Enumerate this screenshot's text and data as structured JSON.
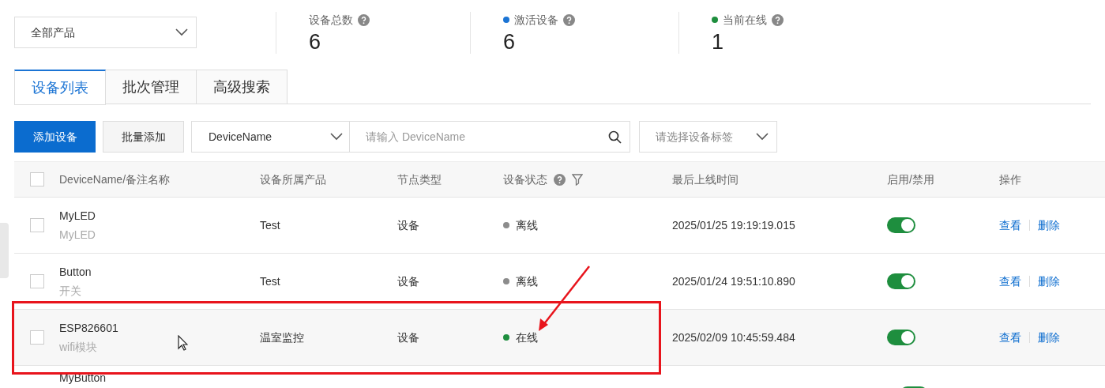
{
  "product_select": {
    "value": "全部产品"
  },
  "stats": [
    {
      "label": "设备总数",
      "value": "6"
    },
    {
      "label": "激活设备",
      "value": "6",
      "color": "#1b74d4"
    },
    {
      "label": "当前在线",
      "value": "1",
      "color": "#1e8e3e"
    }
  ],
  "tabs": [
    {
      "label": "设备列表",
      "selected": true
    },
    {
      "label": "批次管理",
      "selected": false
    },
    {
      "label": "高级搜索",
      "selected": false
    }
  ],
  "toolbar": {
    "add_button": "添加设备",
    "batch_button": "批量添加",
    "field_select": "DeviceName",
    "search": {
      "placeholder": "请输入 DeviceName"
    },
    "tag_select": {
      "placeholder": "请选择设备标签"
    }
  },
  "table": {
    "all_checked": false,
    "columns": [
      "DeviceName/备注名称",
      "设备所属产品",
      "节点类型",
      "设备状态",
      "最后上线时间",
      "启用/禁用",
      "操作"
    ],
    "rows": [
      {
        "name": "MyLED",
        "note": "MyLED",
        "product": "Test",
        "node_type": "设备",
        "status": "离线",
        "color": "#8c8c8c",
        "last_online": "2025/01/25 19:19:19.015",
        "enabled": true,
        "actions": [
          "查看",
          "删除"
        ],
        "hovered": false,
        "checked": false
      },
      {
        "name": "Button",
        "note": "开关",
        "product": "Test",
        "node_type": "设备",
        "status": "离线",
        "color": "#8c8c8c",
        "last_online": "2025/01/24 19:51:10.890",
        "enabled": true,
        "actions": [
          "查看",
          "删除"
        ],
        "hovered": false,
        "checked": false
      },
      {
        "name": "ESP826601",
        "note": "wifi模块",
        "product": "温室监控",
        "node_type": "设备",
        "status": "在线",
        "color": "#1e8e3e",
        "last_online": "2025/02/09 10:45:59.484",
        "enabled": true,
        "actions": [
          "查看",
          "删除"
        ],
        "hovered": true,
        "checked": false
      },
      {
        "name": "MyButton",
        "enabled": true,
        "hovered": false
      }
    ]
  }
}
